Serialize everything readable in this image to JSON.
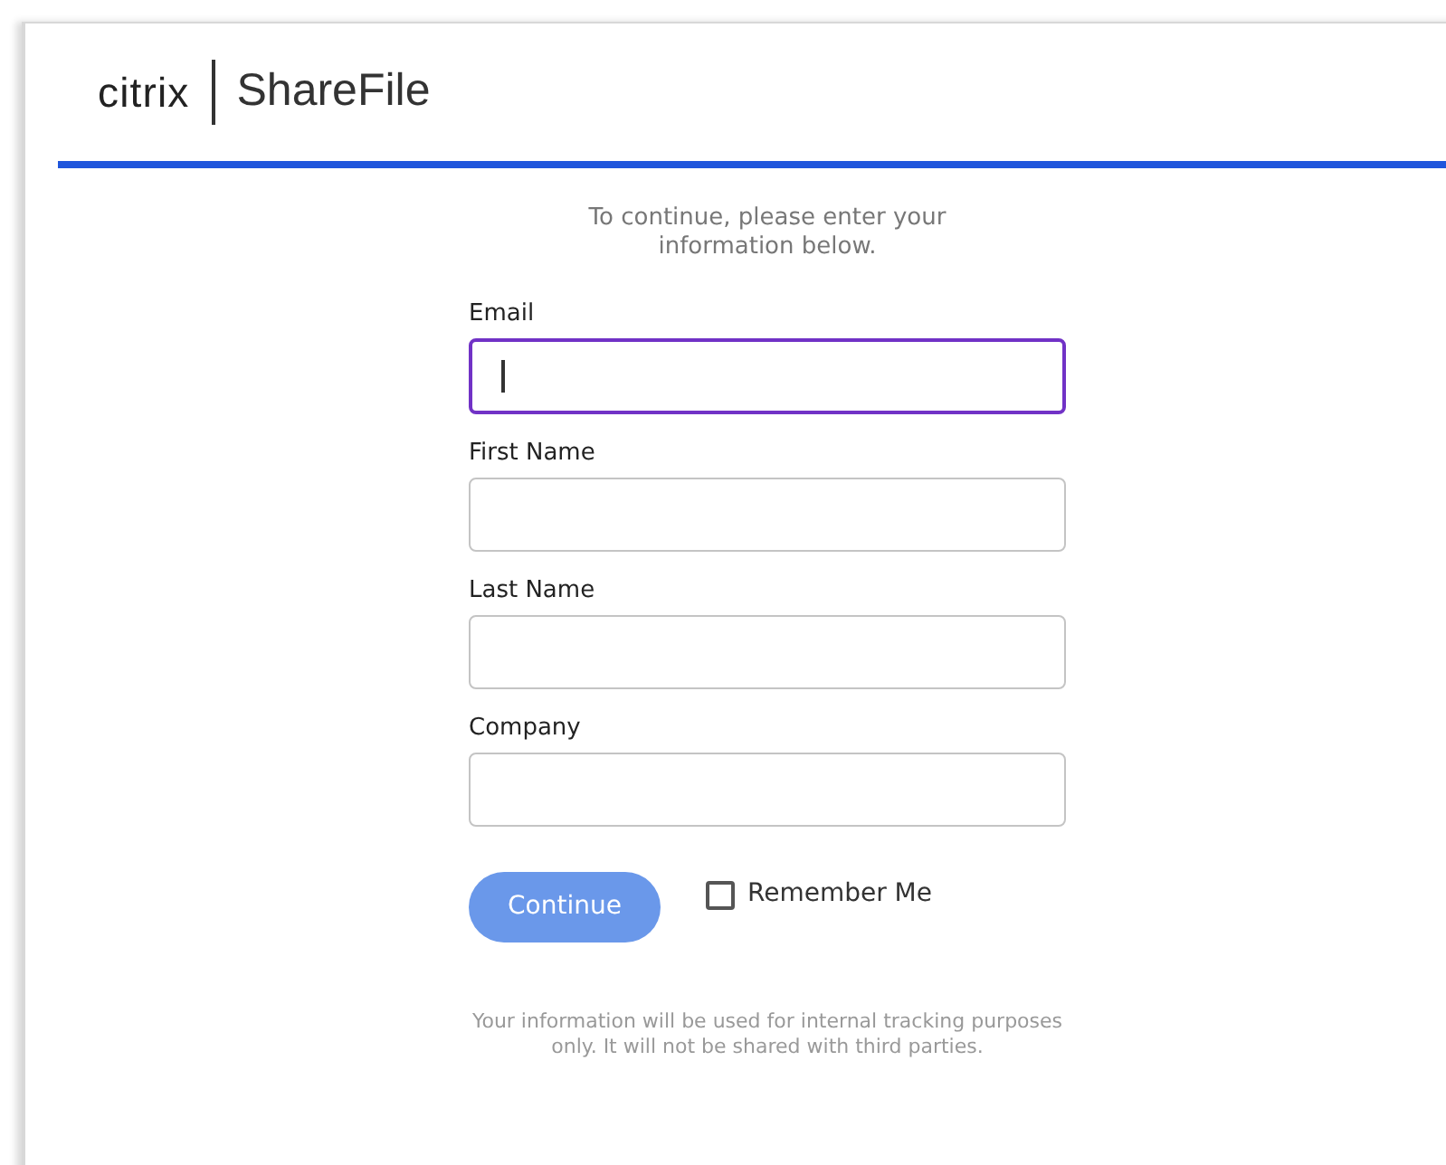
{
  "header": {
    "brand": "citrix",
    "product": "ShareFile"
  },
  "intro": "To continue, please enter your information below.",
  "fields": [
    {
      "label": "Email",
      "focused": true
    },
    {
      "label": "First Name",
      "focused": false
    },
    {
      "label": "Last Name",
      "focused": false
    },
    {
      "label": "Company",
      "focused": false
    }
  ],
  "continue_button": {
    "label": "Continue",
    "disabled": true
  },
  "remember_me": {
    "label": "Remember Me",
    "checked": false
  },
  "footer": "Your information will be used for internal tracking purposes only. It will not be shared with third parties."
}
